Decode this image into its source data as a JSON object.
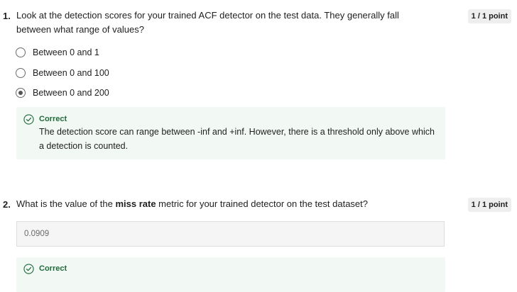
{
  "questions": [
    {
      "number": "1.",
      "text": "Look at the detection scores for your trained ACF detector on the test data. They generally fall between what range of values?",
      "points": "1 / 1 point",
      "options": [
        {
          "label": "Between 0 and 1",
          "selected": false
        },
        {
          "label": "Between 0 and 100",
          "selected": false
        },
        {
          "label": "Between 0 and 200",
          "selected": true
        }
      ],
      "feedback": {
        "status": "Correct",
        "text": "The detection score can range between -inf and +inf. However, there is a threshold only above which a detection is counted."
      }
    },
    {
      "number": "2.",
      "text_before": "What is the value of the ",
      "text_bold": "miss rate",
      "text_after": " metric for your trained detector on the test dataset?",
      "points": "1 / 1 point",
      "answer": "0.0909",
      "feedback": {
        "status": "Correct"
      }
    }
  ],
  "colors": {
    "correct_green": "#1f6b3a",
    "feedback_bg": "#f2f8f4"
  },
  "icons": {
    "feedback": "check-circle-icon"
  }
}
